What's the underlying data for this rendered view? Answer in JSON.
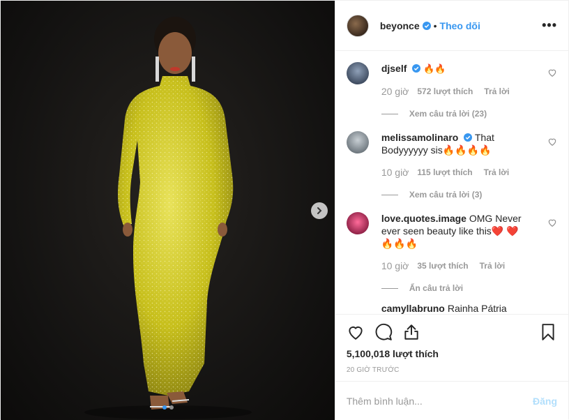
{
  "post": {
    "author": "beyonce",
    "follow_label": "Theo dõi",
    "separator": "•",
    "more_label": "•••"
  },
  "comments": [
    {
      "username": "djself",
      "text": "🔥🔥",
      "time": "20 giờ",
      "likes": "572 lượt thích",
      "reply": "Trả lời",
      "replies": "Xem câu trả lời (23)",
      "verified": true,
      "avatar_color": "#5a6b84"
    },
    {
      "username": "melissamolinaro",
      "text": "That Bodyyyyyy sis🔥🔥🔥🔥",
      "time": "10 giờ",
      "likes": "115 lượt thích",
      "reply": "Trả lời",
      "replies": "Xem câu trả lời (3)",
      "verified": true,
      "avatar_color": "#9aa2a8"
    },
    {
      "username": "love.quotes.image",
      "text": "OMG Never ever seen beauty like this❤️ ❤️ 🔥🔥🔥",
      "time": "10 giờ",
      "likes": "35 lượt thích",
      "reply": "Trả lời",
      "replies": "Ẩn câu trả lời",
      "verified": false,
      "avatar_color": "#d23a6e"
    }
  ],
  "partial_comment": {
    "username": "camyllabruno",
    "text": "Rainha Pátria"
  },
  "likes_count": "5,100,018 lượt thích",
  "posted_ago": "20 GIỜ TRƯỚC",
  "add_comment": {
    "placeholder": "Thêm bình luận...",
    "post_label": "Đăng"
  },
  "carousel": {
    "slide": 1,
    "total": 2
  },
  "colors": {
    "accent": "#3897f0",
    "dress": "#c9c41e",
    "verified": "#3897f0"
  },
  "icons": [
    "heart-icon",
    "comment-icon",
    "share-icon",
    "bookmark-icon",
    "chevron-right-icon",
    "more-icon",
    "verified-icon"
  ]
}
